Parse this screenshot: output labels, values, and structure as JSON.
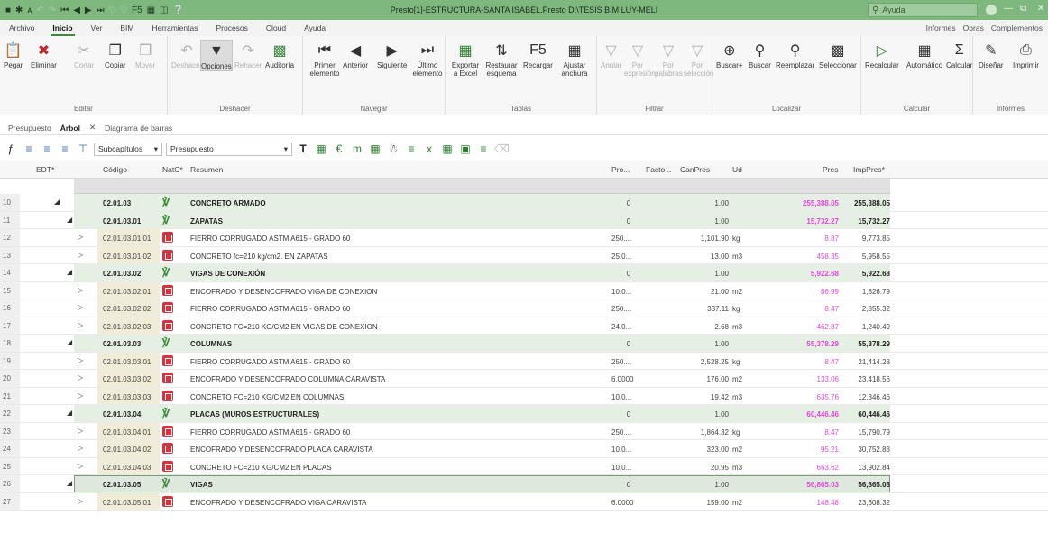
{
  "titlebar": {
    "title": "Presto[1]-ESTRUCTURA-SANTA ISABEL.Presto D:\\TESIS BIM LUY-MELI",
    "search_placeholder": "Ayuda"
  },
  "ribbon_tabs": [
    "Archivo",
    "Inicio",
    "Ver",
    "BIM",
    "Herramientas",
    "Procesos",
    "Cloud",
    "Ayuda"
  ],
  "ribbon_right": [
    "Informes",
    "Obras",
    "Complementos"
  ],
  "groups": {
    "editar": {
      "name": "Editar",
      "buttons": [
        "Pegar",
        "Eliminar",
        "Cortar",
        "Copiar",
        "Mover"
      ]
    },
    "deshacer": {
      "name": "Deshacer",
      "buttons": [
        "Deshacer",
        "Opciones",
        "Rehacer",
        "Auditoría"
      ]
    },
    "navegar": {
      "name": "Navegar",
      "buttons": [
        "Primer elemento",
        "Anterior",
        "Siguiente",
        "Último elemento"
      ]
    },
    "tablas": {
      "name": "Tablas",
      "buttons": [
        "Exportar a Excel",
        "Restaurar esquema",
        "Recargar",
        "Ajustar anchura"
      ]
    },
    "filtrar": {
      "name": "Filtrar",
      "buttons": [
        "Anular",
        "Por expresión",
        "Por palabras",
        "Por selección"
      ]
    },
    "localizar": {
      "name": "Localizar",
      "buttons": [
        "Buscar+",
        "Buscar",
        "Reemplazar",
        "Seleccionar"
      ]
    },
    "calcular": {
      "name": "Calcular",
      "buttons": [
        "Recalcular",
        "Automático",
        "Calcular"
      ]
    },
    "informes": {
      "name": "Informes",
      "buttons": [
        "Diseñar",
        "Imprimir"
      ]
    }
  },
  "doc_tabs": [
    "Presupuesto",
    "Árbol",
    "Diagrama de barras"
  ],
  "toolbar": {
    "combo1": "Subcapítulos",
    "combo2": "Presupuesto"
  },
  "columns": [
    "EDT*",
    "Código",
    "NatC*",
    "Resumen",
    "Pro...",
    "Facto...",
    "CanPres",
    "Ud",
    "Pres",
    "ImpPres*"
  ],
  "rows": [
    {
      "n": "10",
      "code": "02.01.03",
      "kind": "chapter",
      "resumen": "CONCRETO ARMADO",
      "pro": "0",
      "can": "1.00",
      "ud": "",
      "pres": "255,388.05",
      "imp": "255,388.05",
      "lvl": 0
    },
    {
      "n": "11",
      "code": "02.01.03.01",
      "kind": "chapter",
      "resumen": "ZAPATAS",
      "pro": "0",
      "can": "1.00",
      "ud": "",
      "pres": "15,732.27",
      "imp": "15,732.27",
      "lvl": 1
    },
    {
      "n": "12",
      "code": "02.01.03.01.01",
      "kind": "item",
      "resumen": "FIERRO CORRUGADO ASTM A615 - GRADO 60",
      "pro": "250....",
      "can": "1,101.90",
      "ud": "kg",
      "pres": "8.87",
      "imp": "9,773.85",
      "lvl": 2
    },
    {
      "n": "13",
      "code": "02.01.03.01.02",
      "kind": "item",
      "resumen": "CONCRETO fc=210 kg/cm2. EN ZAPATAS",
      "pro": "25.0...",
      "can": "13.00",
      "ud": "m3",
      "pres": "458.35",
      "imp": "5,958.55",
      "lvl": 2
    },
    {
      "n": "14",
      "code": "02.01.03.02",
      "kind": "chapter",
      "resumen": "VIGAS DE CONEXIÓN",
      "pro": "0",
      "can": "1.00",
      "ud": "",
      "pres": "5,922.68",
      "imp": "5,922.68",
      "lvl": 1
    },
    {
      "n": "15",
      "code": "02.01.03.02.01",
      "kind": "item",
      "resumen": "ENCOFRADO Y DESENCOFRADO VIGA DE CONEXION",
      "pro": "10.0...",
      "can": "21.00",
      "ud": "m2",
      "pres": "86.99",
      "imp": "1,826.79",
      "lvl": 2
    },
    {
      "n": "16",
      "code": "02.01.03.02.02",
      "kind": "item",
      "resumen": "FIERRO CORRUGADO ASTM A615 - GRADO 60",
      "pro": "250....",
      "can": "337.11",
      "ud": "kg",
      "pres": "8.47",
      "imp": "2,855.32",
      "lvl": 2
    },
    {
      "n": "17",
      "code": "02.01.03.02.03",
      "kind": "item",
      "resumen": "CONCRETO FC=210 KG/CM2 EN VIGAS DE CONEXION",
      "pro": "24.0...",
      "can": "2.68",
      "ud": "m3",
      "pres": "462.87",
      "imp": "1,240.49",
      "lvl": 2
    },
    {
      "n": "18",
      "code": "02.01.03.03",
      "kind": "chapter",
      "resumen": "COLUMNAS",
      "pro": "0",
      "can": "1.00",
      "ud": "",
      "pres": "55,378.29",
      "imp": "55,378.29",
      "lvl": 1
    },
    {
      "n": "19",
      "code": "02.01.03.03.01",
      "kind": "item",
      "resumen": "FIERRO CORRUGADO ASTM A615 - GRADO 60",
      "pro": "250....",
      "can": "2,528.25",
      "ud": "kg",
      "pres": "8.47",
      "imp": "21,414.28",
      "lvl": 2
    },
    {
      "n": "20",
      "code": "02.01.03.03.02",
      "kind": "item",
      "resumen": "ENCOFRADO Y DESENCOFRADO COLUMNA CARAVISTA",
      "pro": "6.0000",
      "can": "176.00",
      "ud": "m2",
      "pres": "133.06",
      "imp": "23,418.56",
      "lvl": 2
    },
    {
      "n": "21",
      "code": "02.01.03.03.03",
      "kind": "item",
      "resumen": "CONCRETO FC=210 KG/CM2 EN COLUMNAS",
      "pro": "10.0...",
      "can": "19.42",
      "ud": "m3",
      "pres": "635.76",
      "imp": "12,346.46",
      "lvl": 2
    },
    {
      "n": "22",
      "code": "02.01.03.04",
      "kind": "chapter",
      "resumen": "PLACAS (MUROS ESTRUCTURALES)",
      "pro": "0",
      "can": "1.00",
      "ud": "",
      "pres": "60,446.46",
      "imp": "60,446.46",
      "lvl": 1
    },
    {
      "n": "23",
      "code": "02.01.03.04.01",
      "kind": "item",
      "resumen": "FIERRO CORRUGADO ASTM A615 - GRADO 60",
      "pro": "250....",
      "can": "1,864.32",
      "ud": "kg",
      "pres": "8.47",
      "imp": "15,790.79",
      "lvl": 2
    },
    {
      "n": "24",
      "code": "02.01.03.04.02",
      "kind": "item",
      "resumen": "ENCOFRADO Y DESENCOFRADO PLACA CARAVISTA",
      "pro": "10.0...",
      "can": "323.00",
      "ud": "m2",
      "pres": "95.21",
      "imp": "30,752.83",
      "lvl": 2
    },
    {
      "n": "25",
      "code": "02.01.03.04.03",
      "kind": "item",
      "resumen": "CONCRETO FC=210 KG/CM2 EN PLACAS",
      "pro": "10.0...",
      "can": "20.95",
      "ud": "m3",
      "pres": "663.62",
      "imp": "13,902.84",
      "lvl": 2
    },
    {
      "n": "26",
      "code": "02.01.03.05",
      "kind": "chapter",
      "resumen": "VIGAS",
      "pro": "0",
      "can": "1.00",
      "ud": "",
      "pres": "56,865.03",
      "imp": "56,865.03",
      "lvl": 1,
      "selected": true
    },
    {
      "n": "27",
      "code": "02.01.03.05.01",
      "kind": "item",
      "resumen": "ENCOFRADO Y DESENCOFRADO VIGA CARAVISTA",
      "pro": "6.0000",
      "can": "159.00",
      "ud": "m2",
      "pres": "148.48",
      "imp": "23,608.32",
      "lvl": 2
    }
  ]
}
